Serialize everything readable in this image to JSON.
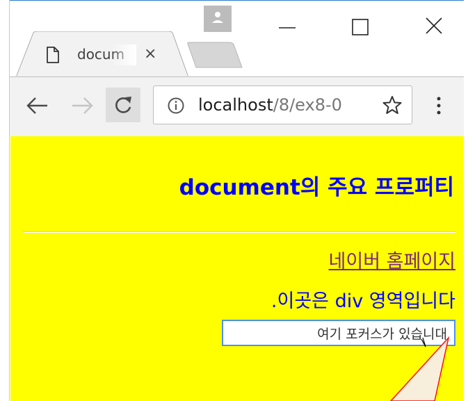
{
  "tab": {
    "title": "docum",
    "close_glyph": "×"
  },
  "address_bar": {
    "host": "localhost",
    "path": "/8/ex8-0"
  },
  "page": {
    "heading": "document의 주요 프로퍼티",
    "link_text": "네이버 홈페이지",
    "div_text": ".이곳은 div 영역입니다",
    "input_value": "여기 포커스가 있습니대",
    "background_color": "#ffff00",
    "heading_color": "#0000ff",
    "link_color": "#7b2a7b"
  },
  "icons": {
    "avatar": "user-avatar-icon",
    "minimize": "minimize-icon",
    "maximize": "maximize-icon",
    "close": "close-icon",
    "page": "page-favicon-icon",
    "back": "back-arrow-icon",
    "forward": "forward-arrow-icon",
    "reload": "reload-icon",
    "info": "info-icon",
    "bookmark": "star-icon",
    "menu": "kebab-menu-icon"
  },
  "annotation": {
    "callout_color": "#ff0000",
    "callout_fill": "#f7eedc"
  }
}
